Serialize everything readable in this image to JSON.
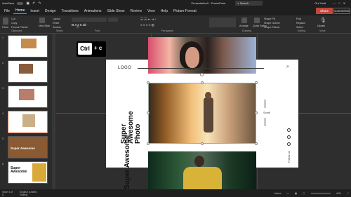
{
  "titlebar": {
    "autosave": "AutoSave",
    "autosave_state": "Off",
    "doc_title": "Presentation2 - PowerPoint",
    "search": "Search",
    "user": "Oni Yindi"
  },
  "tabs": [
    "File",
    "Home",
    "Insert",
    "Design",
    "Transitions",
    "Animations",
    "Slide Show",
    "Review",
    "View",
    "Help",
    "Picture Format"
  ],
  "share": "Share",
  "comments": "Comments",
  "ribbon": {
    "clipboard": {
      "label": "Clipboard",
      "paste": "Paste",
      "cut": "Cut",
      "copy": "Copy",
      "format_painter": "Format Painter"
    },
    "slides": {
      "label": "Slides",
      "new_slide": "New Slide",
      "reuse": "Reuse Slides",
      "layout": "Layout",
      "reset": "Reset",
      "section": "Section"
    },
    "font": {
      "label": "Font"
    },
    "paragraph": {
      "label": "Paragraph"
    },
    "drawing": {
      "label": "Drawing",
      "arrange": "Arrange",
      "quick_styles": "Quick Styles",
      "shape_fill": "Shape Fill",
      "shape_outline": "Shape Outline",
      "shape_effects": "Shape Effects"
    },
    "editing": {
      "label": "Editing",
      "find": "Find",
      "replace": "Replace",
      "select": "Select"
    },
    "voice": {
      "label": "Voice",
      "dictate": "Dictate"
    }
  },
  "thumbnails": [
    {
      "num": "1"
    },
    {
      "num": "2"
    },
    {
      "num": "3"
    },
    {
      "num": "4"
    },
    {
      "num": "5",
      "label": "Super Awesome"
    },
    {
      "num": "6",
      "label": "Super Awesome"
    }
  ],
  "overlay": {
    "ctrl": "Ctrl",
    "plus": "+ c"
  },
  "slide": {
    "logo": "LOGO",
    "title": "Super Awesome Photo",
    "scroll": "Scroll",
    "follow": "Follow us",
    "bottom_title": "Super Awesome"
  },
  "statusbar": {
    "slide_info": "Slide 4 of 6",
    "language": "English (United States)",
    "notes": "Notes",
    "zoom": "40%"
  }
}
